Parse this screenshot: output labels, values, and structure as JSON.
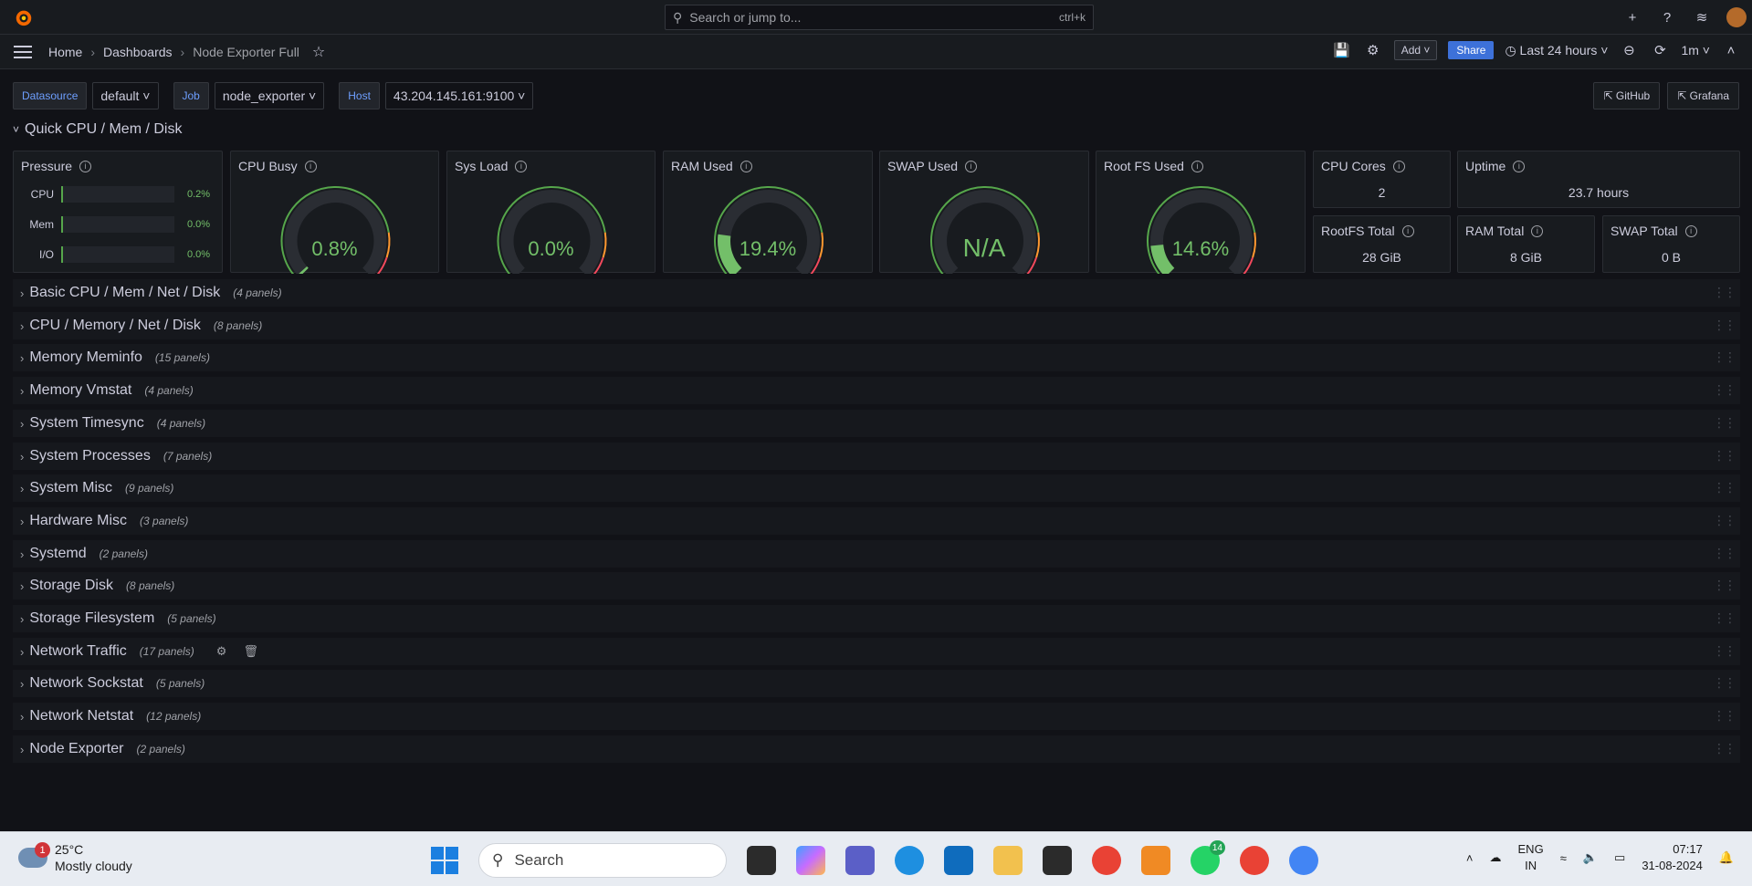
{
  "topbar": {
    "search_placeholder": "Search or jump to...",
    "search_shortcut": "ctrl+k",
    "plus_label": "+"
  },
  "nav": {
    "breadcrumbs": [
      "Home",
      "Dashboards",
      "Node Exporter Full"
    ],
    "add_label": "Add",
    "share_label": "Share",
    "time_range": "Last 24 hours",
    "refresh_interval": "1m"
  },
  "variables": [
    {
      "label": "Datasource",
      "value": "default"
    },
    {
      "label": "Job",
      "value": "node_exporter"
    },
    {
      "label": "Host",
      "value": "43.204.145.161:9100"
    }
  ],
  "links": {
    "github": "GitHub",
    "grafana": "Grafana"
  },
  "quick_row": {
    "title": "Quick CPU / Mem / Disk"
  },
  "pressure": {
    "title": "Pressure",
    "rows": [
      {
        "label": "CPU",
        "value": "0.2%"
      },
      {
        "label": "Mem",
        "value": "0.0%"
      },
      {
        "label": "I/O",
        "value": "0.0%"
      }
    ]
  },
  "gauges": [
    {
      "title": "CPU Busy",
      "value": "0.8%",
      "fraction": 0.008,
      "color": "#73bf69"
    },
    {
      "title": "Sys Load",
      "value": "0.0%",
      "fraction": 0.0,
      "color": "#73bf69"
    },
    {
      "title": "RAM Used",
      "value": "19.4%",
      "fraction": 0.194,
      "color": "#73bf69"
    },
    {
      "title": "SWAP Used",
      "value": "N/A",
      "fraction": 0.0,
      "color": "#73bf69"
    },
    {
      "title": "Root FS Used",
      "value": "14.6%",
      "fraction": 0.146,
      "color": "#73bf69"
    }
  ],
  "stats": [
    {
      "title": "CPU Cores",
      "value": "2"
    },
    {
      "title": "Uptime",
      "value": "23.7 hours"
    },
    {
      "title": "RootFS Total",
      "value": "28 GiB"
    },
    {
      "title": "RAM Total",
      "value": "8 GiB"
    },
    {
      "title": "SWAP Total",
      "value": "0 B"
    }
  ],
  "rows": [
    {
      "title": "Basic CPU / Mem / Net / Disk",
      "count": "(4 panels)"
    },
    {
      "title": "CPU / Memory / Net / Disk",
      "count": "(8 panels)"
    },
    {
      "title": "Memory Meminfo",
      "count": "(15 panels)"
    },
    {
      "title": "Memory Vmstat",
      "count": "(4 panels)"
    },
    {
      "title": "System Timesync",
      "count": "(4 panels)"
    },
    {
      "title": "System Processes",
      "count": "(7 panels)"
    },
    {
      "title": "System Misc",
      "count": "(9 panels)"
    },
    {
      "title": "Hardware Misc",
      "count": "(3 panels)"
    },
    {
      "title": "Systemd",
      "count": "(2 panels)"
    },
    {
      "title": "Storage Disk",
      "count": "(8 panels)"
    },
    {
      "title": "Storage Filesystem",
      "count": "(5 panels)"
    },
    {
      "title": "Network Traffic",
      "count": "(17 panels)"
    },
    {
      "title": "Network Sockstat",
      "count": "(5 panels)"
    },
    {
      "title": "Network Netstat",
      "count": "(12 panels)"
    },
    {
      "title": "Node Exporter",
      "count": "(2 panels)"
    }
  ],
  "taskbar": {
    "temperature": "25°C",
    "weather": "Mostly cloudy",
    "weather_badge": "1",
    "search_label": "Search",
    "whatsapp_badge": "14",
    "lang_top": "ENG",
    "lang_bottom": "IN",
    "time": "07:17",
    "date": "31-08-2024"
  }
}
